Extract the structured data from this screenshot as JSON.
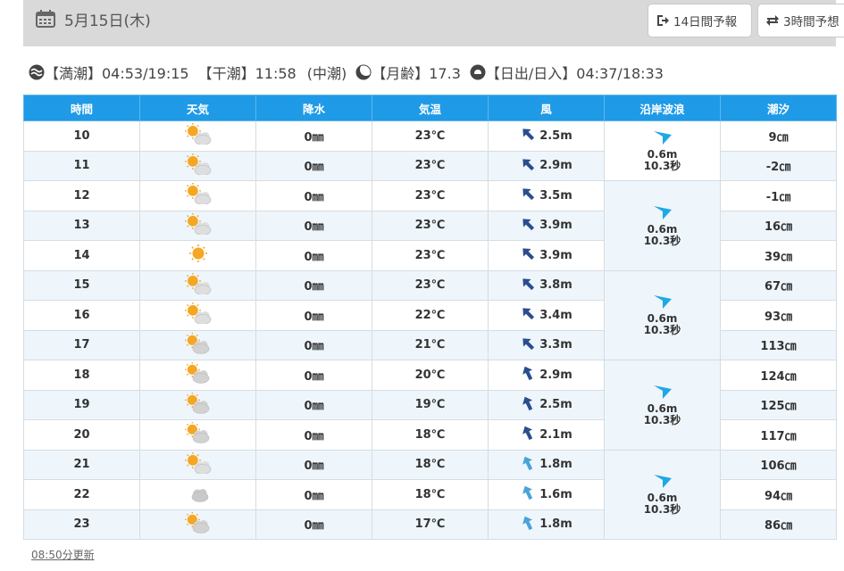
{
  "header": {
    "date": "5月15日(木)",
    "btn_14day": "14日間予報",
    "btn_3hour": "3時間予想"
  },
  "tide": {
    "high": "【満潮】04:53/19:15",
    "low": "【干潮】11:58",
    "phase": "(中潮)",
    "moon": "【月齢】17.3",
    "sun": "【日出/日入】04:37/18:33"
  },
  "columns": [
    "時間",
    "天気",
    "降水",
    "気温",
    "風",
    "沿岸波浪",
    "潮汐"
  ],
  "rows": [
    {
      "hour": "10",
      "weather": "partly-cloudy-icon",
      "rain": "0㎜",
      "temp": "23℃",
      "wind": "2.5m",
      "wind_dir": "NW",
      "tide": "9㎝"
    },
    {
      "hour": "11",
      "weather": "partly-cloudy-icon",
      "rain": "0㎜",
      "temp": "23℃",
      "wind": "2.9m",
      "wind_dir": "NW",
      "tide": "-2㎝"
    },
    {
      "hour": "12",
      "weather": "partly-cloudy-icon",
      "rain": "0㎜",
      "temp": "23℃",
      "wind": "3.5m",
      "wind_dir": "NW",
      "tide": "-1㎝"
    },
    {
      "hour": "13",
      "weather": "partly-cloudy-icon",
      "rain": "0㎜",
      "temp": "23℃",
      "wind": "3.9m",
      "wind_dir": "NW",
      "tide": "16㎝"
    },
    {
      "hour": "14",
      "weather": "sunny-icon",
      "rain": "0㎜",
      "temp": "23℃",
      "wind": "3.9m",
      "wind_dir": "NW",
      "tide": "39㎝"
    },
    {
      "hour": "15",
      "weather": "partly-cloudy-icon",
      "rain": "0㎜",
      "temp": "23℃",
      "wind": "3.8m",
      "wind_dir": "NW",
      "tide": "67㎝"
    },
    {
      "hour": "16",
      "weather": "partly-cloudy-icon",
      "rain": "0㎜",
      "temp": "22℃",
      "wind": "3.4m",
      "wind_dir": "NW",
      "tide": "93㎝"
    },
    {
      "hour": "17",
      "weather": "mostly-cloudy-icon",
      "rain": "0㎜",
      "temp": "21℃",
      "wind": "3.3m",
      "wind_dir": "NW",
      "tide": "113㎝"
    },
    {
      "hour": "18",
      "weather": "mostly-cloudy-icon",
      "rain": "0㎜",
      "temp": "20℃",
      "wind": "2.9m",
      "wind_dir": "NNW",
      "tide": "124㎝"
    },
    {
      "hour": "19",
      "weather": "mostly-cloudy-icon",
      "rain": "0㎜",
      "temp": "19℃",
      "wind": "2.5m",
      "wind_dir": "NNW",
      "tide": "125㎝"
    },
    {
      "hour": "20",
      "weather": "mostly-cloudy-icon",
      "rain": "0㎜",
      "temp": "18℃",
      "wind": "2.1m",
      "wind_dir": "NNW",
      "tide": "117㎝"
    },
    {
      "hour": "21",
      "weather": "partly-cloudy-icon",
      "rain": "0㎜",
      "temp": "18℃",
      "wind": "1.8m",
      "wind_dir": "NNW",
      "tide": "106㎝"
    },
    {
      "hour": "22",
      "weather": "cloudy-icon",
      "rain": "0㎜",
      "temp": "18℃",
      "wind": "1.6m",
      "wind_dir": "NNW",
      "tide": "94㎝"
    },
    {
      "hour": "23",
      "weather": "mostly-cloudy-icon",
      "rain": "0㎜",
      "temp": "17℃",
      "wind": "1.8m",
      "wind_dir": "NNW",
      "tide": "86㎝"
    }
  ],
  "waves": [
    {
      "height": "0.6m",
      "period": "10.3秒"
    },
    {
      "height": "0.6m",
      "period": "10.3秒"
    },
    {
      "height": "0.6m",
      "period": "10.3秒"
    },
    {
      "height": "0.6m",
      "period": "10.3秒"
    },
    {
      "height": "0.6m",
      "period": "10.3秒"
    }
  ],
  "update": "08:50分更新",
  "colors": {
    "header_blue": "#1f9ae6",
    "wind_strong": "#2a4d8f",
    "wind_weak": "#4aa3d8",
    "wave_arrow": "#1fa8e6",
    "sun": "#f5a623"
  }
}
